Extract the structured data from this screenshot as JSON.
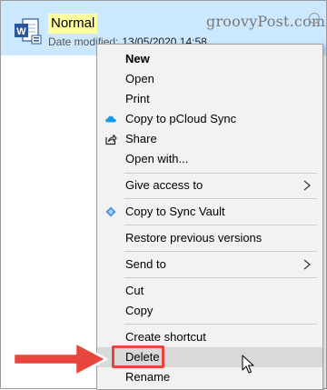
{
  "file": {
    "name": "Normal",
    "date_label": "Date modified:",
    "date_value": "13/05/2020 14:58"
  },
  "watermark": "groovyPost.com",
  "menu": {
    "new": "New",
    "open": "Open",
    "print": "Print",
    "copy_pcloud": "Copy to pCloud Sync",
    "share": "Share",
    "open_with": "Open with...",
    "give_access": "Give access to",
    "copy_sync_vault": "Copy to Sync Vault",
    "restore": "Restore previous versions",
    "send_to": "Send to",
    "cut": "Cut",
    "copy": "Copy",
    "create_shortcut": "Create shortcut",
    "delete": "Delete",
    "rename": "Rename"
  },
  "icons": {
    "file": "word-document-icon",
    "pcloud": "cloud-icon",
    "share": "share-icon",
    "sync_vault": "sync-vault-icon",
    "submenu": "chevron-right-icon"
  },
  "colors": {
    "selection": "#cce8ff",
    "highlight": "#ffffa0",
    "word_blue": "#2b579a",
    "annotation_red": "#e8453c",
    "menu_bg": "#f2f2f2"
  }
}
